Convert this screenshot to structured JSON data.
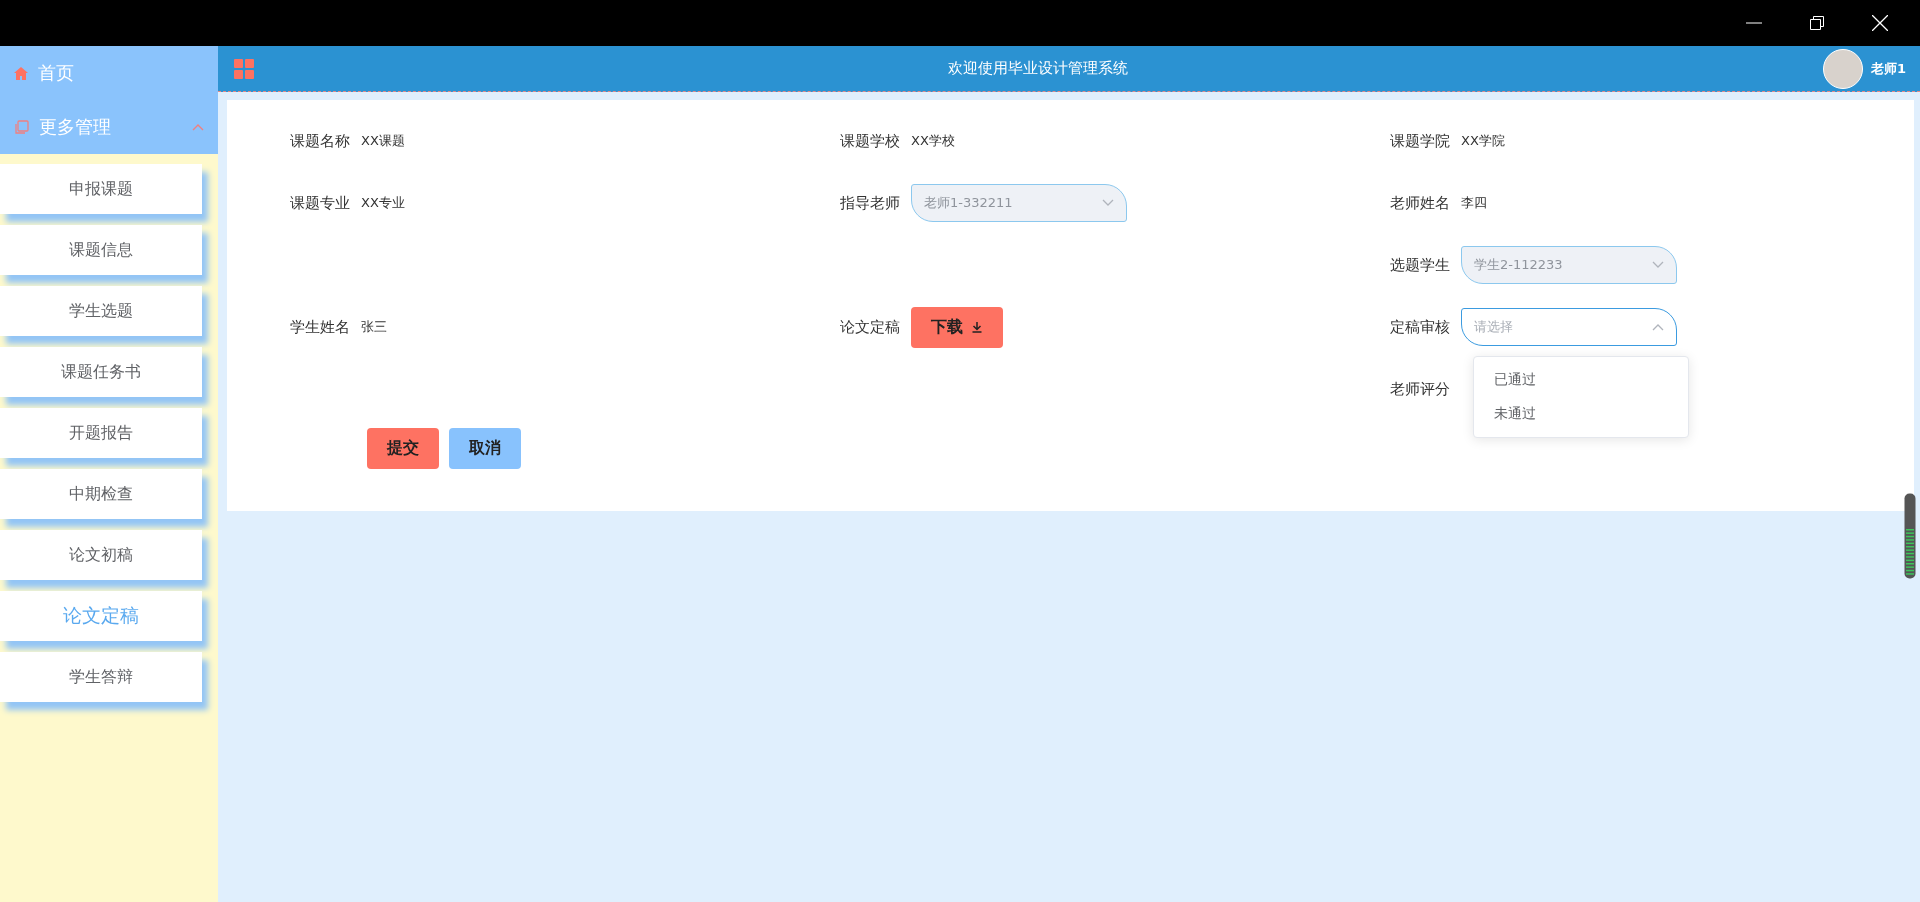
{
  "sidebar": {
    "home": {
      "label": "首页"
    },
    "group": {
      "label": "更多管理",
      "expanded": true
    },
    "items": [
      {
        "label": "申报课题",
        "selected": false
      },
      {
        "label": "课题信息",
        "selected": false
      },
      {
        "label": "学生选题",
        "selected": false
      },
      {
        "label": "课题任务书",
        "selected": false
      },
      {
        "label": "开题报告",
        "selected": false
      },
      {
        "label": "中期检查",
        "selected": false
      },
      {
        "label": "论文初稿",
        "selected": false
      },
      {
        "label": "论文定稿",
        "selected": true
      },
      {
        "label": "学生答辩",
        "selected": false
      }
    ]
  },
  "header": {
    "title": "欢迎使用毕业设计管理系统",
    "user": "老师1"
  },
  "form": {
    "rows": [
      [
        {
          "kind": "text",
          "label": "课题名称",
          "value": "XX课题"
        },
        {
          "kind": "text",
          "label": "课题学校",
          "value": "XX学校"
        },
        {
          "kind": "text",
          "label": "课题学院",
          "value": "XX学院"
        }
      ],
      [
        {
          "kind": "text",
          "label": "课题专业",
          "value": "XX专业"
        },
        {
          "kind": "select",
          "label": "指导老师",
          "value": "老师1-332211",
          "disabled": true,
          "expanded": false
        },
        {
          "kind": "text",
          "label": "老师姓名",
          "value": "李四"
        }
      ],
      [
        null,
        null,
        {
          "kind": "select",
          "label": "选题学生",
          "value": "学生2-112233",
          "disabled": true,
          "expanded": false
        }
      ],
      [
        {
          "kind": "text",
          "label": "学生姓名",
          "value": "张三"
        },
        {
          "kind": "download",
          "label": "论文定稿",
          "button": "下载"
        },
        {
          "kind": "select",
          "label": "定稿审核",
          "placeholder": "请选择",
          "disabled": false,
          "expanded": true,
          "options": [
            {
              "label": "已通过",
              "selected": false
            },
            {
              "label": "未通过",
              "selected": false
            }
          ]
        }
      ],
      [
        null,
        null,
        {
          "kind": "label",
          "label": "老师评分"
        }
      ]
    ],
    "buttons": [
      {
        "label": "提交",
        "kind": "primary"
      },
      {
        "label": "取消",
        "kind": "secondary"
      }
    ]
  }
}
